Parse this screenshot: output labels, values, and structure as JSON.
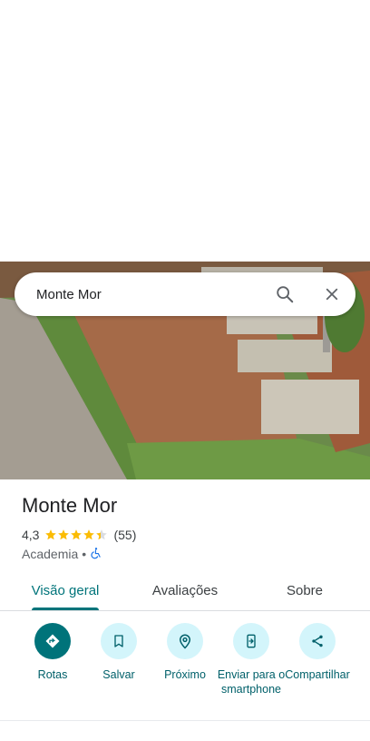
{
  "search": {
    "query": "Monte Mor"
  },
  "place": {
    "title": "Monte Mor",
    "rating": "4,3",
    "rating_value": 4.3,
    "reviews": "(55)",
    "category": "Academia",
    "separator": "•",
    "accessibility_icon": "wheelchair-icon"
  },
  "tabs": [
    {
      "label": "Visão geral",
      "active": true
    },
    {
      "label": "Avaliações",
      "active": false
    },
    {
      "label": "Sobre",
      "active": false
    }
  ],
  "actions": [
    {
      "label": "Rotas",
      "icon": "directions-icon"
    },
    {
      "label": "Salvar",
      "icon": "bookmark-icon"
    },
    {
      "label": "Próximo",
      "icon": "nearby-icon"
    },
    {
      "label": "Enviar para o smartphone",
      "icon": "send-to-phone-icon"
    },
    {
      "label": "Compartilhar",
      "icon": "share-icon"
    }
  ],
  "colors": {
    "accent": "#00747a",
    "action_bg": "#d3f5fb",
    "star": "#fbbc04"
  }
}
